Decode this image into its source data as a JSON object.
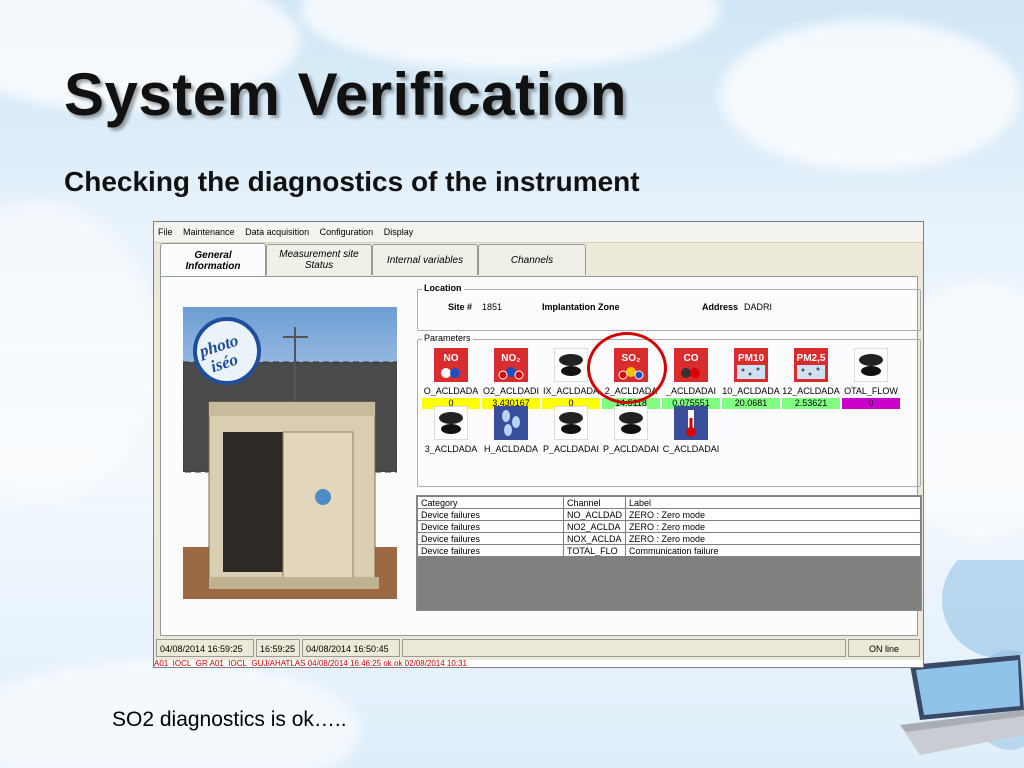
{
  "slide": {
    "title": "System Verification",
    "subtitle": "Checking the diagnostics of the instrument",
    "caption": "SO2 diagnostics is ok….."
  },
  "menu": [
    "File",
    "Maintenance",
    "Data acquisition",
    "Configuration",
    "Display"
  ],
  "tabs": [
    {
      "line1": "General",
      "line2": "Information",
      "active": true
    },
    {
      "line1": "Measurement site",
      "line2": "Status",
      "active": false
    },
    {
      "line1": "Internal variables",
      "line2": "",
      "active": false
    },
    {
      "line1": "Channels",
      "line2": "",
      "active": false
    }
  ],
  "photo": {
    "stamp_line1": "photo",
    "stamp_line2": "iséo"
  },
  "location": {
    "legend": "Location",
    "site_label": "Site #",
    "site_value": "1851",
    "zone_label": "Implantation Zone",
    "address_label": "Address",
    "address_value": "DADRI"
  },
  "parameters": {
    "legend": "Parameters",
    "row1": [
      {
        "icon": "no-gas-icon",
        "badge": "NO",
        "name": "O_ACLDADA",
        "value": "0",
        "value_color": "#ffff00"
      },
      {
        "icon": "no2-gas-icon",
        "badge": "NO₂",
        "name": "O2_ACLDADI",
        "value": "3.430167",
        "value_color": "#ffff00"
      },
      {
        "icon": "blank-sensor-icon",
        "badge": "",
        "name": "IX_ACLDADA",
        "value": "0",
        "value_color": "#ffff00"
      },
      {
        "icon": "so2-gas-icon",
        "badge": "SO₂",
        "name": "2_ACLDADA",
        "value": "14.5118",
        "value_color": "#80ff80"
      },
      {
        "icon": "co-gas-icon",
        "badge": "CO",
        "name": "_ACLDADAI",
        "value": "0.075551",
        "value_color": "#80ff80"
      },
      {
        "icon": "pm10-icon",
        "badge": "PM10",
        "name": "10_ACLDADA",
        "value": "20.0681",
        "value_color": "#80ff80"
      },
      {
        "icon": "pm25-icon",
        "badge": "PM2,5",
        "name": "12_ACLDADA",
        "value": "2.53621",
        "value_color": "#80ff80"
      },
      {
        "icon": "blank-sensor-icon",
        "badge": "",
        "name": "OTAL_FLOW",
        "value": "0",
        "value_color": "#cc00cc"
      }
    ],
    "row2": [
      {
        "icon": "blank-sensor-icon",
        "badge": "",
        "name": "3_ACLDADA"
      },
      {
        "icon": "rain-icon",
        "badge": "",
        "name": "H_ACLDADA"
      },
      {
        "icon": "blank-sensor-icon",
        "badge": "",
        "name": "P_ACLDADAI"
      },
      {
        "icon": "blank-sensor-icon",
        "badge": "",
        "name": "P_ACLDADAI"
      },
      {
        "icon": "thermometer-icon",
        "badge": "",
        "name": "C_ACLDADAI"
      }
    ]
  },
  "diagnostics": {
    "columns": [
      "Category",
      "Channel",
      "Label"
    ],
    "rows": [
      [
        "Device failures",
        "NO_ACLDAD",
        "ZERO : Zero mode"
      ],
      [
        "Device failures",
        "NO2_ACLDA",
        "ZERO : Zero mode"
      ],
      [
        "Device failures",
        "NOX_ACLDA",
        "ZERO : Zero mode"
      ],
      [
        "Device failures",
        "TOTAL_FLO",
        "Communication failure"
      ]
    ]
  },
  "status": {
    "datetime": "04/08/2014 16:59:25",
    "time": "16:59:25",
    "last": "04/08/2014 16:50:45",
    "state": "ON line",
    "cut_row": "A01_IOCL_GR          A01_IOCL_GUJ/AHATLAS          04/08/2014 16:46:25        ok          ok      02/08/2014 10:31"
  }
}
